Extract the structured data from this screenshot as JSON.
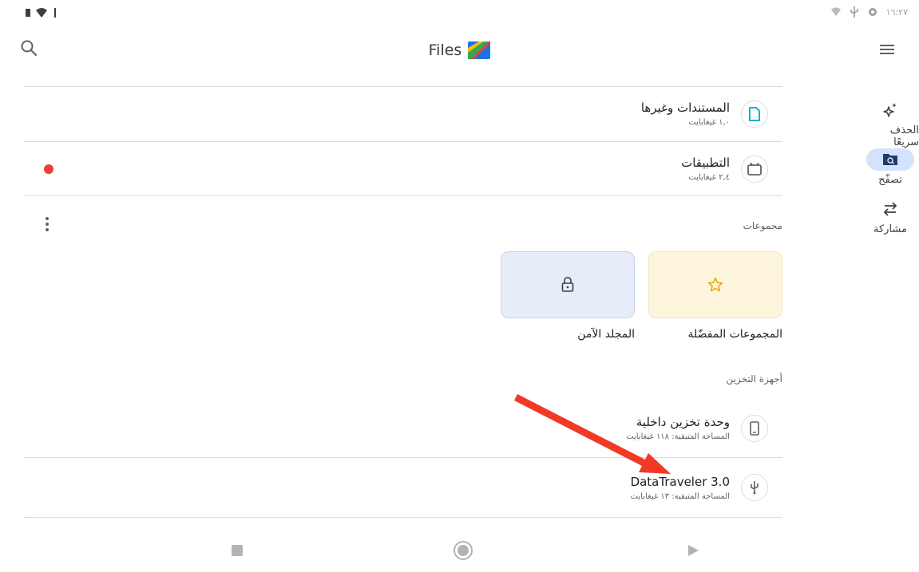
{
  "status_bar": {
    "time": "١٦:٢٧"
  },
  "app_bar": {
    "title": "Files"
  },
  "categories": [
    {
      "name": "المستندات وغيرها",
      "size": "١,٠ غيغابايت",
      "icon": "document-icon"
    },
    {
      "name": "التطبيقات",
      "size": "٢,٤ غيغابايت",
      "icon": "android-app-icon"
    }
  ],
  "collections": {
    "section_label": "مجموعات",
    "cards": [
      {
        "label": "المجموعات المفضّلة",
        "icon": "star-icon",
        "color": "#fdf5dc"
      },
      {
        "label": "المجلد الآمن",
        "icon": "lock-icon",
        "color": "#e6edf8"
      }
    ]
  },
  "storage": {
    "section_label": "أجهزة التخزين",
    "devices": [
      {
        "name": "وحدة تخزين داخلية",
        "free": "المساحة المتبقية: ١١٨ غيغابايت",
        "icon": "phone-icon"
      },
      {
        "name": "DataTraveler 3.0",
        "free": "المساحة المتبقية: ١٣ غيغابايت",
        "icon": "usb-icon"
      }
    ]
  },
  "nav_rail": {
    "items": [
      {
        "label": "الحذف سريعًا",
        "icon": "sparkle-icon",
        "active": false
      },
      {
        "label": "تصفّح",
        "icon": "browse-folder-icon",
        "active": true
      },
      {
        "label": "مشاركة",
        "icon": "share-swap-icon",
        "active": false
      }
    ]
  },
  "colors": {
    "accent": "#d3e3fd",
    "notification_dot": "#ea4335",
    "annotation_arrow": "#f03a26"
  }
}
